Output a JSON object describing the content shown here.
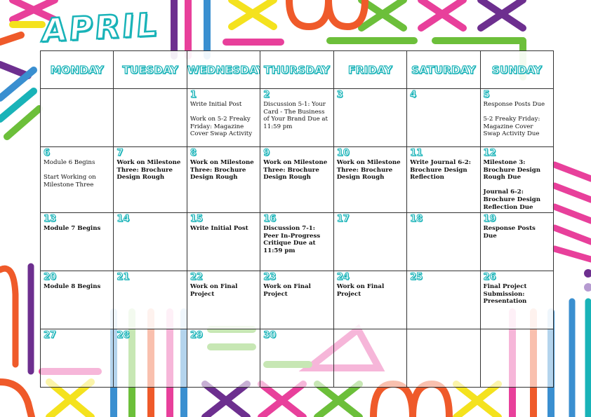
{
  "title": "APRIL",
  "days_of_week": [
    "MONDAY",
    "TUESDAY",
    "WEDNESDAY",
    "THURSDAY",
    "FRIDAY",
    "SATURDAY",
    "SUNDAY"
  ],
  "weeks": [
    [
      {
        "day": "",
        "text": "",
        "bold": false
      },
      {
        "day": "",
        "text": "",
        "bold": false
      },
      {
        "day": "1",
        "text": "Write Initial Post\n\nWork on 5-2 Freaky Friday: Magazine Cover Swap Activity",
        "bold": false
      },
      {
        "day": "2",
        "text": "Discussion 5-1: Your Card - The Business of Your Brand Due at 11:59 pm",
        "bold": false
      },
      {
        "day": "3",
        "text": "",
        "bold": false
      },
      {
        "day": "4",
        "text": "",
        "bold": false
      },
      {
        "day": "5",
        "text": "Response Posts Due\n\n5-2 Freaky Friday: Magazine Cover Swap Activity Due",
        "bold": false
      }
    ],
    [
      {
        "day": "6",
        "text": "Module 6 Begins\n\nStart Working on Milestone Three",
        "bold": false
      },
      {
        "day": "7",
        "text": "Work on Milestone Three: Brochure Design Rough",
        "bold": true
      },
      {
        "day": "8",
        "text": "Work on Milestone Three: Brochure Design Rough",
        "bold": true
      },
      {
        "day": "9",
        "text": "Work on Milestone Three: Brochure Design Rough",
        "bold": true
      },
      {
        "day": "10",
        "text": "Work on Milestone Three: Brochure Design Rough",
        "bold": true
      },
      {
        "day": "11",
        "text": "Write Journal 6-2: Brochure Design Reflection",
        "bold": true
      },
      {
        "day": "12",
        "text": "Milestone 3: Brochure Design Rough Due\n\nJournal 6-2: Brochure Design Reflection Due",
        "bold": true
      }
    ],
    [
      {
        "day": "13",
        "text": "Module 7 Begins",
        "bold": true
      },
      {
        "day": "14",
        "text": "",
        "bold": false
      },
      {
        "day": "15",
        "text": "Write Initial Post",
        "bold": true
      },
      {
        "day": "16",
        "text": "Discussion 7-1: Peer In-Progress Critique Due at 11:59 pm",
        "bold": true
      },
      {
        "day": "17",
        "text": "",
        "bold": false
      },
      {
        "day": "18",
        "text": "",
        "bold": false
      },
      {
        "day": "19",
        "text": "Response Posts Due",
        "bold": true
      }
    ],
    [
      {
        "day": "20",
        "text": "Module 8 Begins",
        "bold": true
      },
      {
        "day": "21",
        "text": "",
        "bold": false
      },
      {
        "day": "22",
        "text": "Work on Final Project",
        "bold": true
      },
      {
        "day": "23",
        "text": "Work on Final Project",
        "bold": true
      },
      {
        "day": "24",
        "text": "Work on Final Project",
        "bold": true
      },
      {
        "day": "25",
        "text": "",
        "bold": false
      },
      {
        "day": "26",
        "text": "Final Project Submission: Presentation",
        "bold": true
      }
    ],
    [
      {
        "day": "27",
        "text": "",
        "bold": false
      },
      {
        "day": "28",
        "text": "",
        "bold": false
      },
      {
        "day": "29",
        "text": "",
        "bold": false
      },
      {
        "day": "30",
        "text": "",
        "bold": false
      },
      {
        "day": "",
        "text": "",
        "bold": false
      },
      {
        "day": "",
        "text": "",
        "bold": false
      },
      {
        "day": "",
        "text": "",
        "bold": false
      }
    ]
  ],
  "colors": {
    "accent": "#19b3b8",
    "pink": "#e8409b",
    "orange": "#ef5a2a",
    "yellow": "#f4e21e",
    "green": "#6cbf3a",
    "purple": "#6d2f8f",
    "blue": "#3a8fd0"
  }
}
